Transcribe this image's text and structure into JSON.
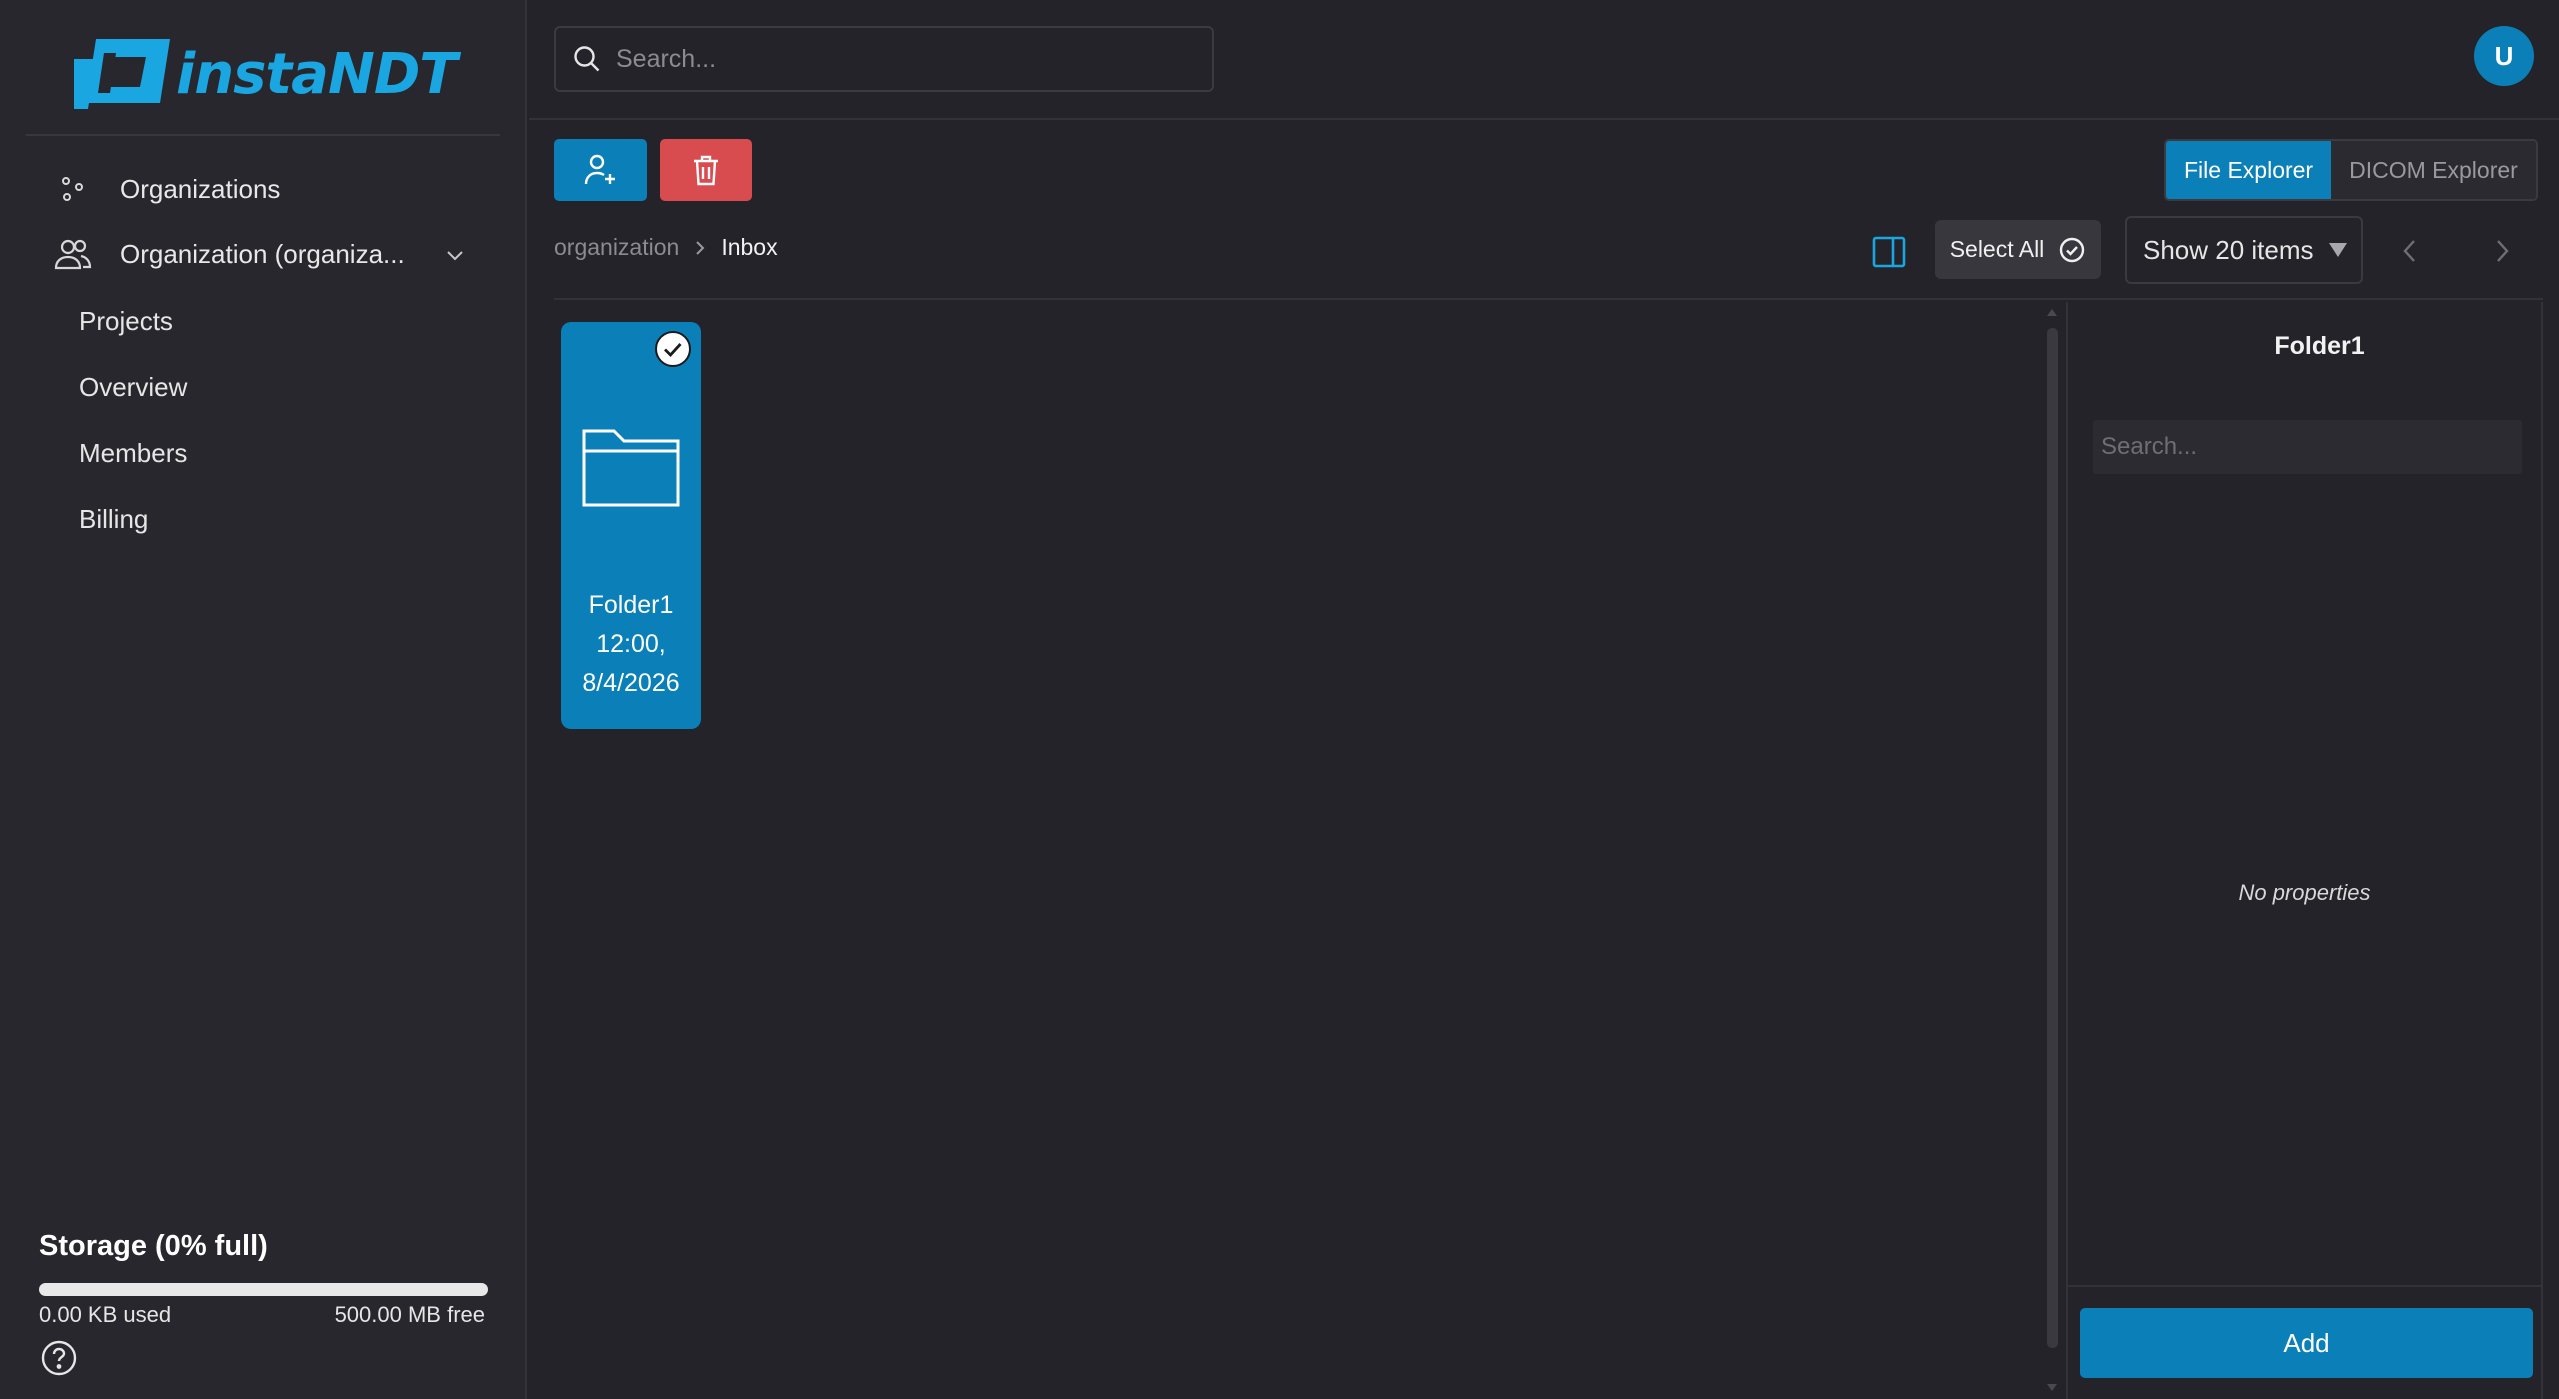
{
  "app": {
    "logo_text": "instaNDT"
  },
  "sidebar": {
    "items": [
      {
        "label": "Organizations",
        "icon": "organizations-icon"
      },
      {
        "label": "Organization (organiza...",
        "icon": "users-icon"
      }
    ],
    "subitems": [
      {
        "label": "Projects"
      },
      {
        "label": "Overview"
      },
      {
        "label": "Members"
      },
      {
        "label": "Billing"
      }
    ],
    "storage": {
      "title": "Storage (0% full)",
      "used": "0.00 KB used",
      "free": "500.00 MB free",
      "percent": 0
    }
  },
  "header": {
    "search_placeholder": "Search...",
    "avatar_initial": "U"
  },
  "toolbar": {
    "view_tabs": [
      {
        "label": "File Explorer",
        "active": true
      },
      {
        "label": "DICOM Explorer",
        "active": false
      }
    ],
    "select_all_label": "Select All",
    "page_size_label": "Show 20 items"
  },
  "breadcrumb": [
    "organization",
    "Inbox"
  ],
  "files": [
    {
      "name": "Folder1",
      "time": "12:00,",
      "date": "8/4/2026",
      "selected": true
    }
  ],
  "details_panel": {
    "title": "Folder1",
    "search_placeholder": "Search...",
    "empty_text": "No properties",
    "add_label": "Add"
  },
  "colors": {
    "accent": "#0a7fb8",
    "danger": "#d84b4f",
    "background": "#242329"
  }
}
